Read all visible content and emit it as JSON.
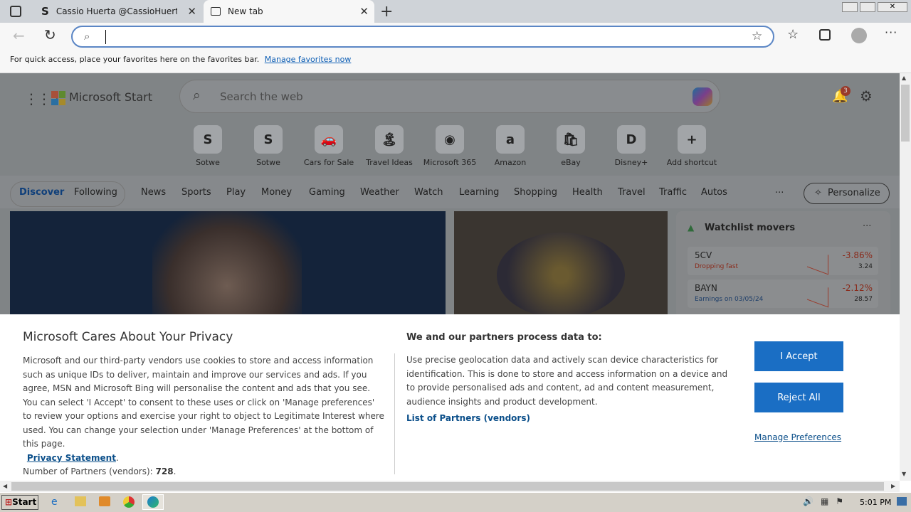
{
  "tabs": [
    {
      "title": "Cassio Huerta @CassioHuerta - T"
    },
    {
      "title": "New tab"
    }
  ],
  "addressbar": {
    "value": ""
  },
  "favorites_bar": {
    "text": "For quick access, place your favorites here on the favorites bar.",
    "link": "Manage favorites now"
  },
  "msn": {
    "brand": "Microsoft Start",
    "search_placeholder": "Search the web",
    "notification_count": "3",
    "shortcuts": [
      {
        "label": "Sotwe",
        "glyph": "S"
      },
      {
        "label": "Sotwe",
        "glyph": "S"
      },
      {
        "label": "Cars for Sale",
        "glyph": "🚗"
      },
      {
        "label": "Travel Ideas",
        "glyph": "🏝"
      },
      {
        "label": "Microsoft 365",
        "glyph": "◉"
      },
      {
        "label": "Amazon",
        "glyph": "a"
      },
      {
        "label": "eBay",
        "glyph": "🛍"
      },
      {
        "label": "Disney+",
        "glyph": "D"
      },
      {
        "label": "Add shortcut",
        "glyph": "+"
      }
    ],
    "nav": [
      "Discover",
      "Following",
      "News",
      "Sports",
      "Play",
      "Money",
      "Gaming",
      "Weather",
      "Watch",
      "Learning",
      "Shopping",
      "Health",
      "Travel",
      "Traffic",
      "Autos"
    ],
    "more": "···",
    "personalize": "Personalize",
    "watchlist": {
      "title": "Watchlist movers",
      "items": [
        {
          "symbol": "5CV",
          "sub": "Dropping fast",
          "change": "-3.86%",
          "price": "3.24"
        },
        {
          "symbol": "BAYN",
          "sub": "Earnings on 03/05/24",
          "change": "-2.12%",
          "price": "28.57"
        }
      ]
    }
  },
  "privacy": {
    "title": "Microsoft Cares About Your Privacy",
    "body": "Microsoft and our third-party vendors use cookies to store and access information such as unique IDs to deliver, maintain and improve our services and ads. If you agree, MSN and Microsoft Bing will personalise the content and ads that you see. You can select 'I Accept' to consent to these uses or click on 'Manage preferences' to review your options and exercise your right to object to Legitimate Interest where used.  You can change your selection under 'Manage Preferences' at the bottom of this page.",
    "privacy_link": "Privacy Statement",
    "partners_label": "Number of Partners (vendors):",
    "partners_count": "728",
    "process_title": "We and our partners process data to:",
    "process_body": "Use precise geolocation data and actively scan device characteristics for identification. This is done to store and access information on a device and to provide personalised ads and content, ad and content measurement, audience insights and product development.",
    "partners_link": "List of Partners (vendors)",
    "accept": "I Accept",
    "reject": "Reject All",
    "manage": "Manage Preferences"
  },
  "taskbar": {
    "start": "Start",
    "time": "5:01 PM"
  }
}
